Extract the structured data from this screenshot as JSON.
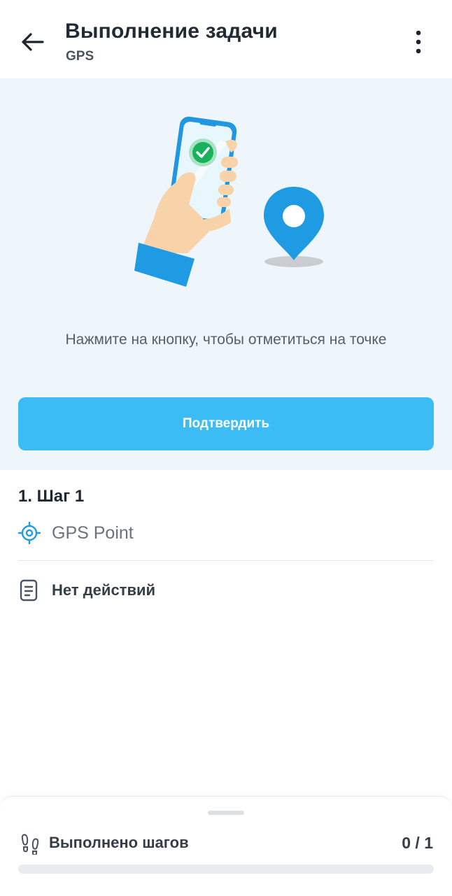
{
  "header": {
    "title": "Выполнение задачи",
    "subtitle": "GPS",
    "back_icon": "arrow-left-icon",
    "menu_icon": "more-vertical-icon"
  },
  "hero": {
    "illustration": "hand-holding-phone-with-location-pin",
    "instruction": "Нажмите на кнопку, чтобы отметиться на точке",
    "confirm_label": "Подтвердить"
  },
  "step": {
    "title": "1. Шаг 1",
    "point_icon": "gps-target-icon",
    "point_label": "GPS Point",
    "actions_icon": "document-icon",
    "actions_label": "Нет действий"
  },
  "footer": {
    "icon": "footsteps-icon",
    "label": "Выполнено шагов",
    "count": "0 / 1",
    "progress_fraction": 0
  },
  "colors": {
    "accent": "#3bbcf5",
    "pin": "#1f9be3",
    "hero_background": "#eef6fb",
    "check": "#19b25c"
  }
}
